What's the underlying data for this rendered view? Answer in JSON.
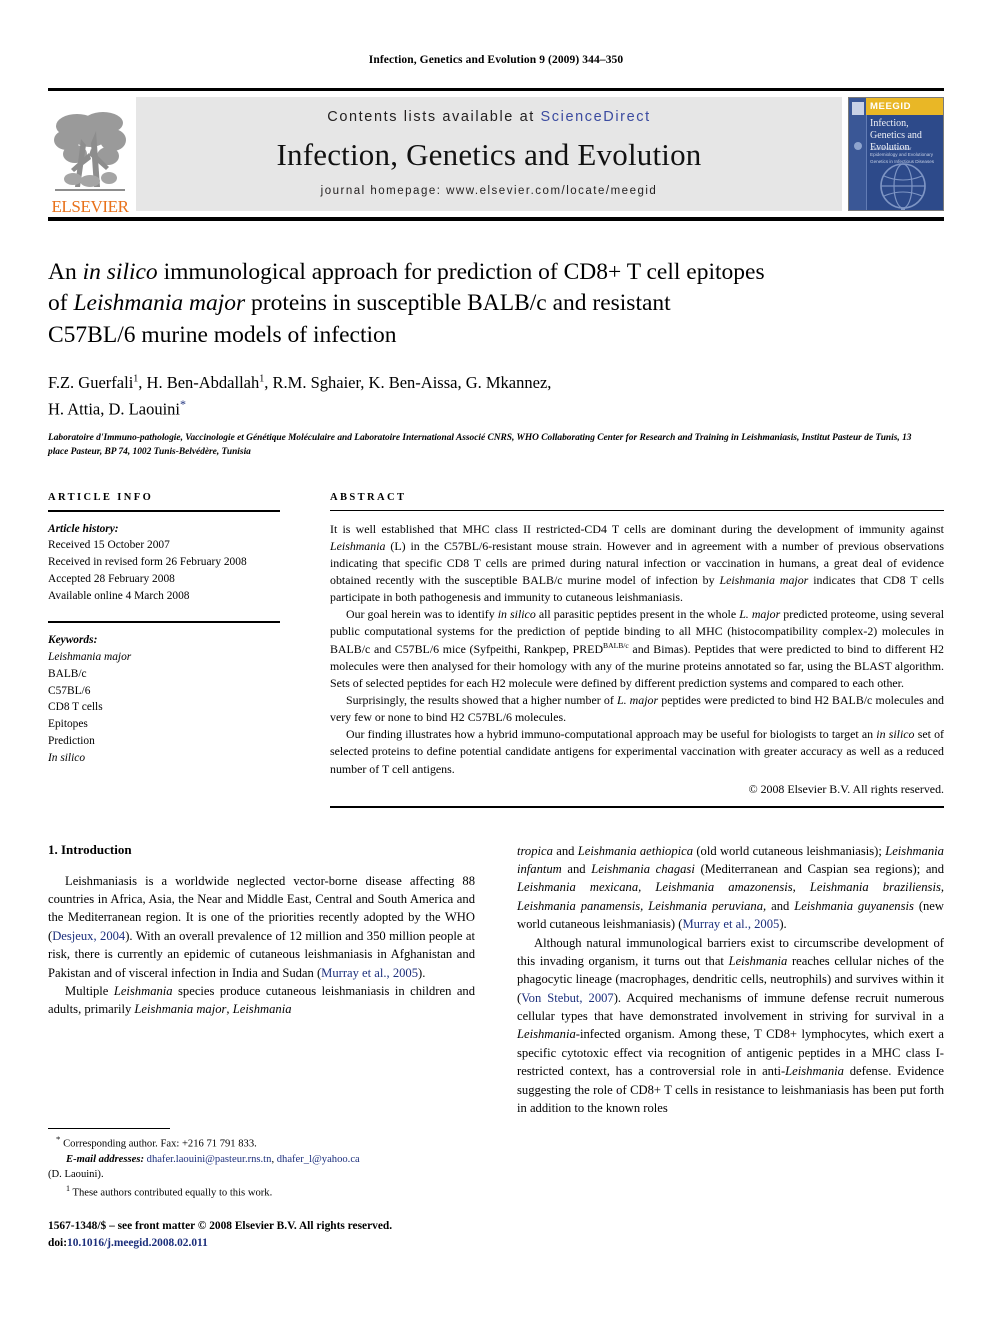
{
  "running_head": "Infection, Genetics and Evolution 9 (2009) 344–350",
  "masthead": {
    "contents_prefix": "Contents lists available at ",
    "contents_link": "ScienceDirect",
    "journal_title": "Infection, Genetics and Evolution",
    "homepage": "journal homepage: www.elsevier.com/locate/meegid",
    "publisher": "ELSEVIER",
    "cover": {
      "banner": "MEEGID",
      "title": "Infection, Genetics and Evolution",
      "subtitle": "Journal of Molecular Epidemiology and Evolutionary Genetics in Infectious Diseases"
    }
  },
  "article": {
    "title_line1_a": "An ",
    "title_line1_b": "in silico",
    "title_line1_c": " immunological approach for prediction of CD8+ T cell epitopes",
    "title_line2_a": "of ",
    "title_line2_b": "Leishmania major",
    "title_line2_c": " proteins in susceptible BALB/c and resistant",
    "title_line3": "C57BL/6 murine models of infection",
    "authors_line1": "F.Z. Guerfali",
    "authors_line1_rest": ", H. Ben-Abdallah",
    "authors_line1_tail": ", R.M. Sghaier, K. Ben-Aissa, G. Mkannez,",
    "authors_line2": "H. Attia, D. Laouini",
    "author_mark_1": "1",
    "author_mark_2": "1",
    "author_star": "*",
    "affiliation": "Laboratoire d'Immuno-pathologie, Vaccinologie et Génétique Moléculaire and Laboratoire International Associé CNRS, WHO Collaborating Center for Research and Training in Leishmaniasis, Institut Pasteur de Tunis, 13 place Pasteur, BP 74, 1002 Tunis-Belvédère, Tunisia"
  },
  "info": {
    "section_label": "ARTICLE INFO",
    "history_heading": "Article history:",
    "history": [
      "Received 15 October 2007",
      "Received in revised form 26 February 2008",
      "Accepted 28 February 2008",
      "Available online 4 March 2008"
    ],
    "keywords_heading": "Keywords:",
    "keywords": [
      "Leishmania major",
      "BALB/c",
      "C57BL/6",
      "CD8 T cells",
      "Epitopes",
      "Prediction",
      "In silico"
    ]
  },
  "abstract": {
    "section_label": "ABSTRACT",
    "para1_pre": "It is well established that MHC class II restricted-CD4 T cells are dominant during the development of immunity against ",
    "para1_it1": "Leishmania",
    "para1_mid1": " (L) in the C57BL/6-resistant mouse strain. However and in agreement with a number of previous observations indicating that specific CD8 T cells are primed during natural infection or vaccination in humans, a great deal of evidence obtained recently with the susceptible BALB/c murine model of infection by ",
    "para1_it2": "Leishmania major",
    "para1_end": " indicates that CD8 T cells participate in both pathogenesis and immunity to cutaneous leishmaniasis.",
    "para2_pre": "Our goal herein was to identify ",
    "para2_it1": "in silico",
    "para2_mid1": " all parasitic peptides present in the whole ",
    "para2_it2": "L. major",
    "para2_mid2": " predicted proteome, using several public computational systems for the prediction of peptide binding to all MHC (histocompatibility complex-2) molecules in BALB/c and C57BL/6 mice (Syfpeithi, Rankpep, PRED",
    "para2_sup": "BALB/c",
    "para2_end": " and Bimas). Peptides that were predicted to bind to different H2 molecules were then analysed for their homology with any of the murine proteins annotated so far, using the BLAST algorithm. Sets of selected peptides for each H2 molecule were defined by different prediction systems and compared to each other.",
    "para3_pre": "Surprisingly, the results showed that a higher number of ",
    "para3_it1": "L. major",
    "para3_end": " peptides were predicted to bind H2 BALB/c molecules and very few or none to bind H2 C57BL/6 molecules.",
    "para4_pre": "Our finding illustrates how a hybrid immuno-computational approach may be useful for biologists to target an ",
    "para4_it1": "in silico",
    "para4_end": " set of selected proteins to define potential candidate antigens for experimental vaccination with greater accuracy as well as a reduced number of T cell antigens.",
    "copyright": "© 2008 Elsevier B.V. All rights reserved."
  },
  "introduction": {
    "heading": "1. Introduction",
    "left": {
      "p1_a": "Leishmaniasis is a worldwide neglected vector-borne disease affecting 88 countries in Africa, Asia, the Near and Middle East, Central and South America and the Mediterranean region. It is one of the priorities recently adopted by the WHO (",
      "p1_ref1": "Desjeux, 2004",
      "p1_b": "). With an overall prevalence of 12 million and 350 million people at risk, there is currently an epidemic of cutaneous leishmaniasis in Afghanistan and Pakistan and of visceral infection in India and Sudan (",
      "p1_ref2": "Murray et al., 2005",
      "p1_c": ").",
      "p2_a": "Multiple ",
      "p2_it1": "Leishmania",
      "p2_b": " species produce cutaneous leishmaniasis in children and adults, primarily ",
      "p2_it2": "Leishmania major",
      "p2_c": ", ",
      "p2_it3": "Leishmania"
    },
    "right": {
      "p1_it1": "tropica",
      "p1_a": " and ",
      "p1_it2": "Leishmania aethiopica",
      "p1_b": " (old world cutaneous leishmaniasis); ",
      "p1_it3": "Leishmania infantum",
      "p1_c": " and ",
      "p1_it4": "Leishmania chagasi",
      "p1_d": " (Mediterranean and Caspian sea regions); and ",
      "p1_it5": "Leishmania mexicana, Leishmania amazonensis, Leishmania braziliensis, Leishmania panamensis, Leishmania peruviana,",
      "p1_e": " and ",
      "p1_it6": "Leishmania guyanensis",
      "p1_f": " (new world cutaneous leishmaniasis) (",
      "p1_ref1": "Murray et al., 2005",
      "p1_g": ").",
      "p2_a": "Although natural immunological barriers exist to circumscribe development of this invading organism, it turns out that ",
      "p2_it1": "Leishmania",
      "p2_b": " reaches cellular niches of the phagocytic lineage (macrophages, dendritic cells, neutrophils) and survives within it (",
      "p2_ref1": "Von Stebut, 2007",
      "p2_c": "). Acquired mechanisms of immune defense recruit numerous cellular types that have demonstrated involvement in striving for survival in a ",
      "p2_it2": "Leishmania",
      "p2_d": "-infected organism. Among these, T CD8+ lymphocytes, which exert a specific cytotoxic effect via recognition of antigenic peptides in a MHC class I-restricted context, has a controversial role in anti-",
      "p2_it3": "Leishmania",
      "p2_e": " defense. Evidence suggesting the role of CD8+ T cells in resistance to leishmaniasis has been put forth in addition to the known roles"
    }
  },
  "footnotes": {
    "corresponding_mark": "*",
    "corresponding": "Corresponding author. Fax: +216 71 791 833.",
    "email_label": "E-mail addresses:",
    "email1": "dhafer.laouini@pasteur.rns.tn",
    "email_sep": ", ",
    "email2": "dhafer_l@yahoo.ca",
    "email_owner": "(D. Laouini).",
    "equal_mark": "1",
    "equal_note": "These authors contributed equally to this work."
  },
  "frontmatter": {
    "line1": "1567-1348/$ – see front matter © 2008 Elsevier B.V. All rights reserved.",
    "doi_label": "doi:",
    "doi_value": "10.1016/j.meegid.2008.02.011"
  }
}
